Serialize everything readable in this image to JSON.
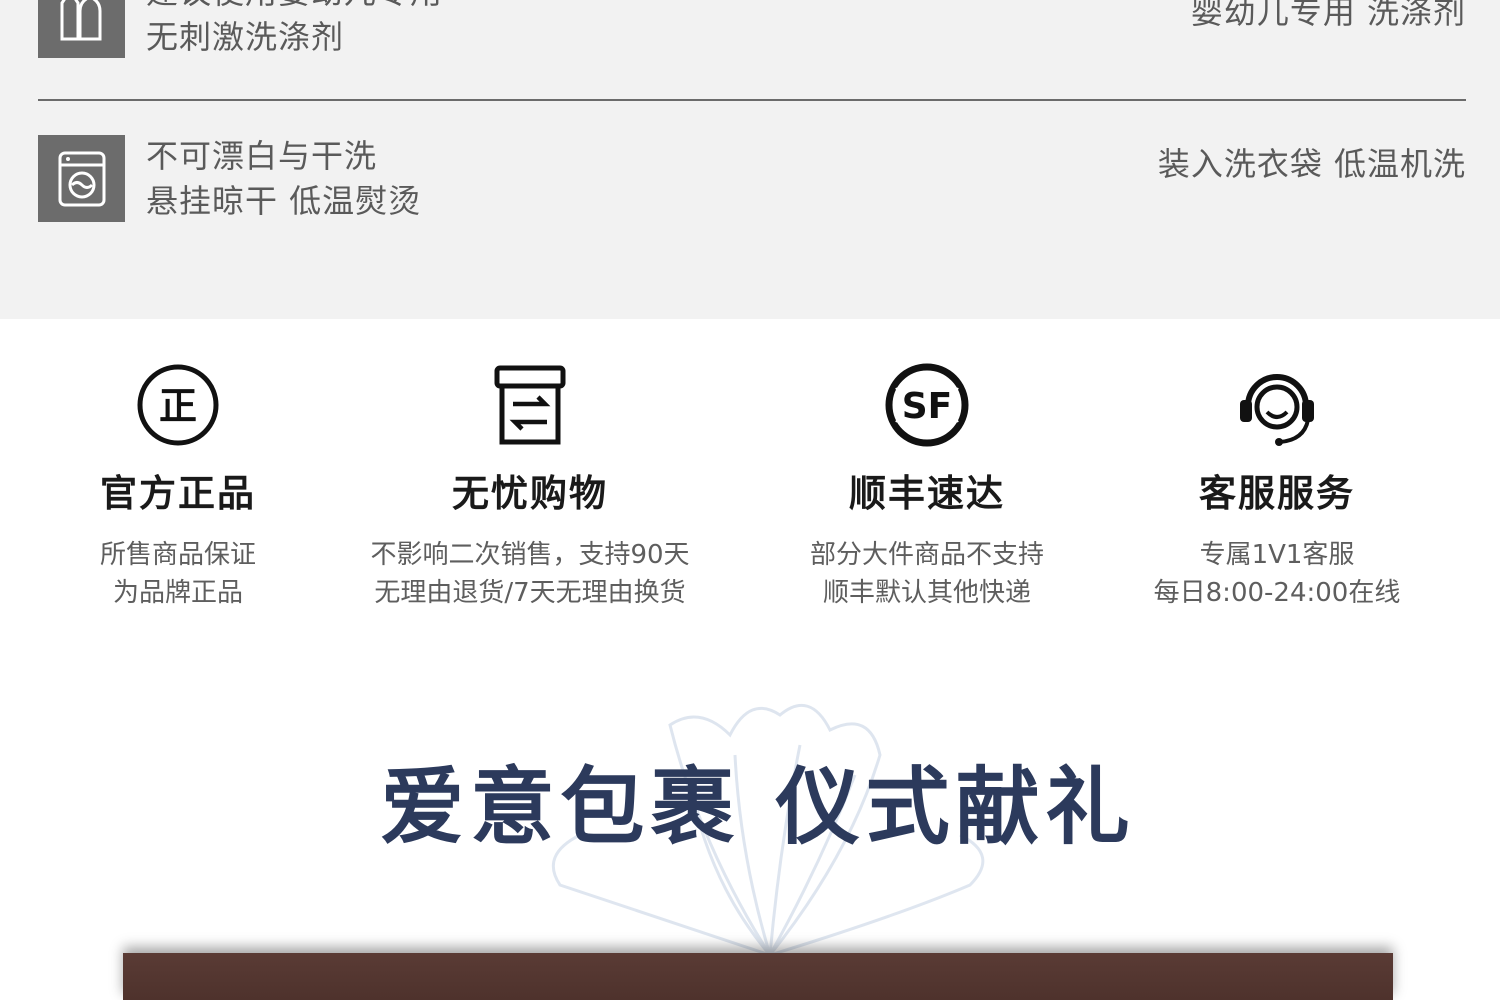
{
  "care": {
    "rows": [
      {
        "icon": "baby-detergent-icon",
        "lines": [
          "建议使用婴幼儿专用",
          "无刺激洗涤剂"
        ],
        "right": "婴幼儿专用 洗涤剂"
      },
      {
        "icon": "washing-machine-icon",
        "lines": [
          "不可漂白与干洗",
          "悬挂晾干 低温熨烫"
        ],
        "right": "装入洗衣袋 低温机洗"
      }
    ]
  },
  "services": [
    {
      "icon": "authentic-circle-icon",
      "icon_text": "正",
      "title": "官方正品",
      "desc": [
        "所售商品保证",
        "为品牌正品"
      ]
    },
    {
      "icon": "return-exchange-box-icon",
      "title": "无忧购物",
      "desc": [
        "不影响二次销售，支持90天",
        "无理由退货/7天无理由换货"
      ]
    },
    {
      "icon": "sf-express-logo-icon",
      "icon_text": "SF",
      "title": "顺丰速达",
      "desc": [
        "部分大件商品不支持",
        "顺丰默认其他快递"
      ]
    },
    {
      "icon": "customer-service-headset-icon",
      "title": "客服服务",
      "desc": [
        "专属1V1客服",
        "每日8:00-24:00在线"
      ]
    }
  ],
  "banner": {
    "title": "爱意包裹 仪式献礼",
    "title_color": "#2c3a5c"
  },
  "colors": {
    "care_bg": "#f2f2f2",
    "care_icon_bg": "#6c6c6c",
    "text_dark": "#1a1a1a",
    "text_grey": "#5e5e5e",
    "photo_brown": "#5a3b35"
  }
}
